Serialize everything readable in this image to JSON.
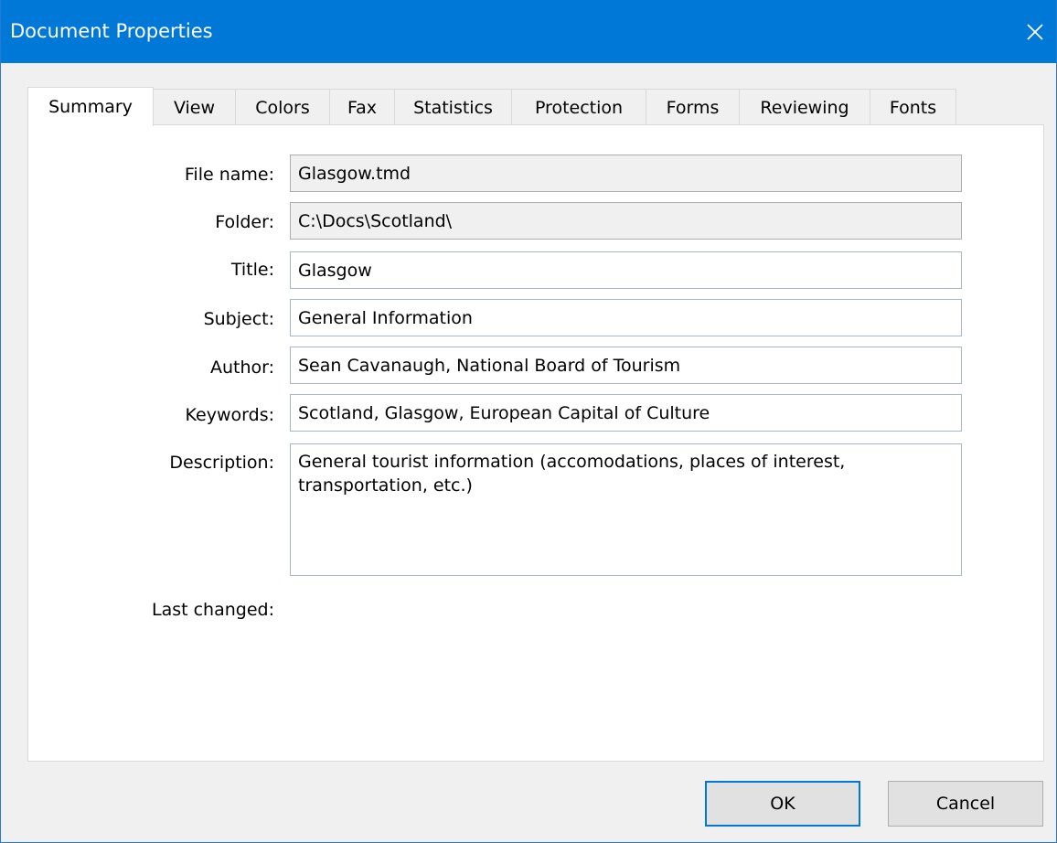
{
  "window": {
    "title": "Document Properties"
  },
  "tabs": [
    {
      "label": "Summary",
      "active": true
    },
    {
      "label": "View"
    },
    {
      "label": "Colors"
    },
    {
      "label": "Fax"
    },
    {
      "label": "Statistics"
    },
    {
      "label": "Protection"
    },
    {
      "label": "Forms"
    },
    {
      "label": "Reviewing"
    },
    {
      "label": "Fonts"
    }
  ],
  "summary": {
    "file_name": {
      "label": "File name:",
      "value": "Glasgow.tmd"
    },
    "folder": {
      "label": "Folder:",
      "value": "C:\\Docs\\Scotland\\"
    },
    "title": {
      "label": "Title:",
      "value": "Glasgow"
    },
    "subject": {
      "label": "Subject:",
      "value": "General Information"
    },
    "author": {
      "label": "Author:",
      "value": "Sean Cavanaugh, National Board of Tourism"
    },
    "keywords": {
      "label": "Keywords:",
      "value": "Scotland, Glasgow, European Capital of Culture"
    },
    "description": {
      "label": "Description:",
      "value": "General tourist information (accomodations, places of interest, transportation, etc.)"
    },
    "last_changed": {
      "label": "Last changed:"
    }
  },
  "buttons": {
    "ok": "OK",
    "cancel": "Cancel"
  },
  "colors": {
    "titlebar": "#0078d7",
    "accent": "#0078d7"
  }
}
